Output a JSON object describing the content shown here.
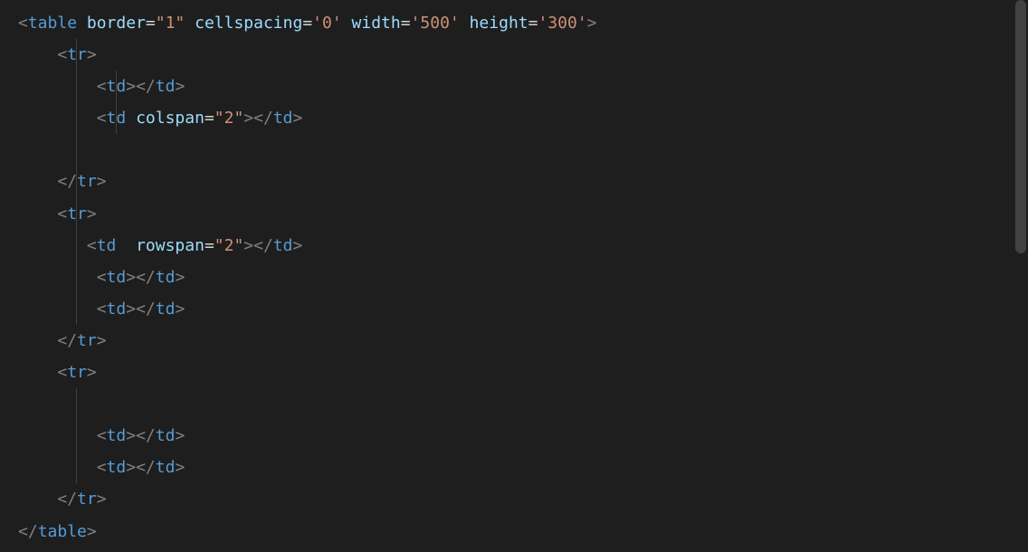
{
  "code": {
    "lines": [
      {
        "indent": 0,
        "tokens": [
          {
            "type": "bracket",
            "text": "<"
          },
          {
            "type": "tag",
            "text": "table"
          },
          {
            "type": "text",
            "text": " "
          },
          {
            "type": "attr-name",
            "text": "border"
          },
          {
            "type": "text",
            "text": "="
          },
          {
            "type": "attr-value",
            "text": "\"1\""
          },
          {
            "type": "text",
            "text": " "
          },
          {
            "type": "attr-name",
            "text": "cellspacing"
          },
          {
            "type": "text",
            "text": "="
          },
          {
            "type": "attr-value",
            "text": "'0'"
          },
          {
            "type": "text",
            "text": " "
          },
          {
            "type": "attr-name",
            "text": "width"
          },
          {
            "type": "text",
            "text": "="
          },
          {
            "type": "attr-value",
            "text": "'500'"
          },
          {
            "type": "text",
            "text": " "
          },
          {
            "type": "attr-name",
            "text": "height"
          },
          {
            "type": "text",
            "text": "="
          },
          {
            "type": "attr-value",
            "text": "'300'"
          },
          {
            "type": "bracket",
            "text": ">"
          }
        ]
      },
      {
        "indent": 1,
        "guides": [
          1
        ],
        "tokens": [
          {
            "type": "bracket",
            "text": "<"
          },
          {
            "type": "tag",
            "text": "tr"
          },
          {
            "type": "bracket",
            "text": ">"
          }
        ]
      },
      {
        "indent": 2,
        "guides": [
          1,
          2
        ],
        "tokens": [
          {
            "type": "bracket",
            "text": "<"
          },
          {
            "type": "tag",
            "text": "td"
          },
          {
            "type": "bracket",
            "text": "></"
          },
          {
            "type": "tag",
            "text": "td"
          },
          {
            "type": "bracket",
            "text": ">"
          }
        ]
      },
      {
        "indent": 2,
        "guides": [
          1,
          2
        ],
        "tokens": [
          {
            "type": "bracket",
            "text": "<"
          },
          {
            "type": "tag",
            "text": "td"
          },
          {
            "type": "text",
            "text": " "
          },
          {
            "type": "attr-name",
            "text": "colspan"
          },
          {
            "type": "text",
            "text": "="
          },
          {
            "type": "attr-value",
            "text": "\"2\""
          },
          {
            "type": "bracket",
            "text": "></"
          },
          {
            "type": "tag",
            "text": "td"
          },
          {
            "type": "bracket",
            "text": ">"
          }
        ]
      },
      {
        "indent": 2,
        "guides": [
          1
        ],
        "tokens": []
      },
      {
        "indent": 1,
        "guides": [
          1
        ],
        "tokens": [
          {
            "type": "bracket",
            "text": "</"
          },
          {
            "type": "tag",
            "text": "tr"
          },
          {
            "type": "bracket",
            "text": ">"
          }
        ]
      },
      {
        "indent": 1,
        "guides": [
          1
        ],
        "tokens": [
          {
            "type": "bracket",
            "text": "<"
          },
          {
            "type": "tag",
            "text": "tr"
          },
          {
            "type": "bracket",
            "text": ">"
          }
        ]
      },
      {
        "indent": 2,
        "guides": [
          1
        ],
        "nospace": true,
        "tokens": [
          {
            "type": "bracket",
            "text": "<"
          },
          {
            "type": "tag",
            "text": "td"
          },
          {
            "type": "text",
            "text": "  "
          },
          {
            "type": "attr-name",
            "text": "rowspan"
          },
          {
            "type": "text",
            "text": "="
          },
          {
            "type": "attr-value",
            "text": "\"2\""
          },
          {
            "type": "bracket",
            "text": "></"
          },
          {
            "type": "tag",
            "text": "td"
          },
          {
            "type": "bracket",
            "text": ">"
          }
        ]
      },
      {
        "indent": 2,
        "guides": [
          1
        ],
        "tokens": [
          {
            "type": "bracket",
            "text": "<"
          },
          {
            "type": "tag",
            "text": "td"
          },
          {
            "type": "bracket",
            "text": "></"
          },
          {
            "type": "tag",
            "text": "td"
          },
          {
            "type": "bracket",
            "text": ">"
          }
        ]
      },
      {
        "indent": 2,
        "guides": [
          1
        ],
        "tokens": [
          {
            "type": "bracket",
            "text": "<"
          },
          {
            "type": "tag",
            "text": "td"
          },
          {
            "type": "bracket",
            "text": "></"
          },
          {
            "type": "tag",
            "text": "td"
          },
          {
            "type": "bracket",
            "text": ">"
          }
        ]
      },
      {
        "indent": 1,
        "tokens": [
          {
            "type": "bracket",
            "text": "</"
          },
          {
            "type": "tag",
            "text": "tr"
          },
          {
            "type": "bracket",
            "text": ">"
          }
        ]
      },
      {
        "indent": 1,
        "tokens": [
          {
            "type": "bracket",
            "text": "<"
          },
          {
            "type": "tag",
            "text": "tr"
          },
          {
            "type": "bracket",
            "text": ">"
          }
        ]
      },
      {
        "indent": 2,
        "guides": [
          1
        ],
        "tokens": []
      },
      {
        "indent": 2,
        "guides": [
          1
        ],
        "tokens": [
          {
            "type": "bracket",
            "text": "<"
          },
          {
            "type": "tag",
            "text": "td"
          },
          {
            "type": "bracket",
            "text": "></"
          },
          {
            "type": "tag",
            "text": "td"
          },
          {
            "type": "bracket",
            "text": ">"
          }
        ]
      },
      {
        "indent": 2,
        "guides": [
          1
        ],
        "tokens": [
          {
            "type": "bracket",
            "text": "<"
          },
          {
            "type": "tag",
            "text": "td"
          },
          {
            "type": "bracket",
            "text": "></"
          },
          {
            "type": "tag",
            "text": "td"
          },
          {
            "type": "bracket",
            "text": ">"
          }
        ]
      },
      {
        "indent": 1,
        "tokens": [
          {
            "type": "bracket",
            "text": "</"
          },
          {
            "type": "tag",
            "text": "tr"
          },
          {
            "type": "bracket",
            "text": ">"
          }
        ]
      },
      {
        "indent": 0,
        "tokens": [
          {
            "type": "bracket",
            "text": "</"
          },
          {
            "type": "tag",
            "text": "table"
          },
          {
            "type": "bracket",
            "text": ">"
          }
        ]
      }
    ]
  }
}
